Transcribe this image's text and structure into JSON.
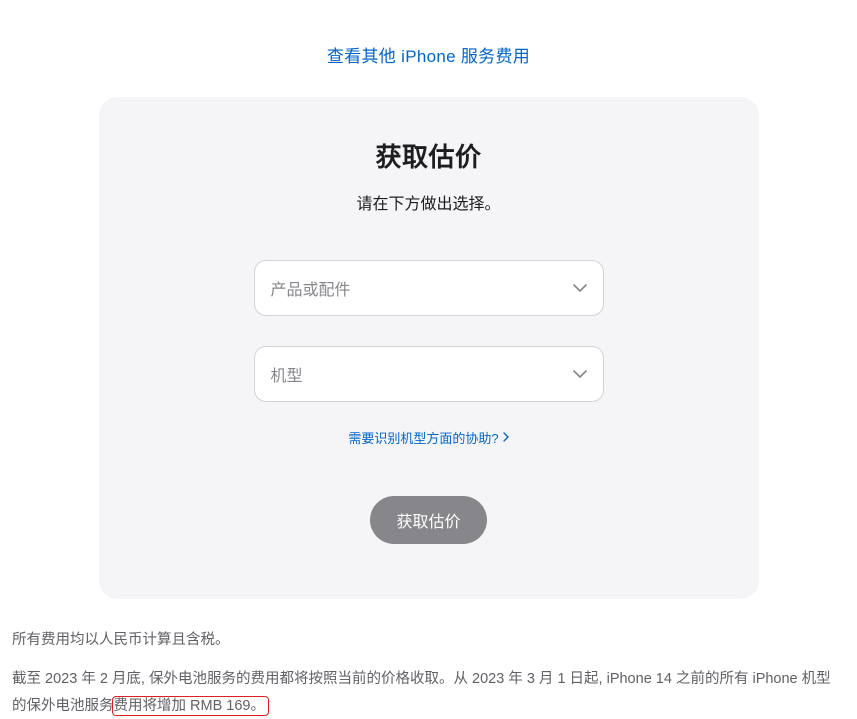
{
  "topLink": {
    "label": "查看其他 iPhone 服务费用"
  },
  "card": {
    "title": "获取估价",
    "subtitle": "请在下方做出选择。",
    "select1": {
      "placeholder": "产品或配件"
    },
    "select2": {
      "placeholder": "机型"
    },
    "helpLink": {
      "label": "需要识别机型方面的协助?"
    },
    "submit": {
      "label": "获取估价"
    }
  },
  "footer": {
    "line1": "所有费用均以人民币计算且含税。",
    "line2_part1": "截至 2023 年 2 月底, 保外电池服务的费用都将按照当前的价格收取。从 2023 年 3 月 1 日起, iPhone 14 之前的所有 iPhone 机型的保外电池服务",
    "line2_highlight": "费用将增加 RMB 169。"
  }
}
